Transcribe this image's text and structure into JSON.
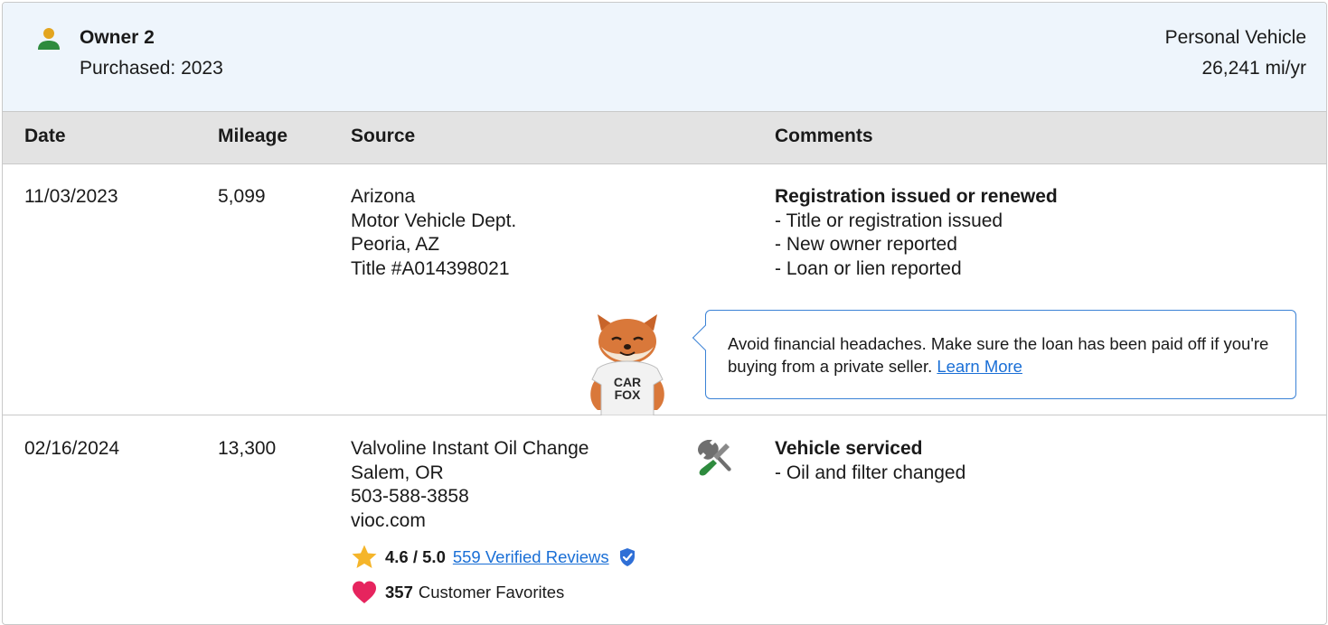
{
  "owner": {
    "title": "Owner 2",
    "purchased": "Purchased: 2023",
    "vehicle_type": "Personal Vehicle",
    "annual_mileage": "26,241 mi/yr",
    "icon": "person-icon"
  },
  "table": {
    "headers": {
      "date": "Date",
      "mileage": "Mileage",
      "source": "Source",
      "comments": "Comments"
    },
    "rows": [
      {
        "date": "11/03/2023",
        "mileage": "5,099",
        "source": [
          "Arizona",
          "Motor Vehicle Dept.",
          "Peoria, AZ",
          "Title #A014398021"
        ],
        "comment_title": "Registration issued or renewed",
        "comments": [
          "- Title or registration issued",
          "- New owner reported",
          "- Loan or lien reported"
        ],
        "callout": {
          "text": "Avoid financial headaches. Make sure the loan has been paid off if you're buying from a private seller.",
          "link": "Learn More"
        },
        "mascot_label": [
          "CAR",
          "FOX"
        ]
      },
      {
        "date": "02/16/2024",
        "mileage": "13,300",
        "source": [
          "Valvoline Instant Oil Change",
          "Salem, OR",
          "503-588-3858",
          "vioc.com"
        ],
        "comment_title": "Vehicle serviced",
        "comments": [
          "- Oil and filter changed"
        ],
        "icon": "wrench-screwdriver-icon",
        "rating": {
          "value": "4.6 / 5.0",
          "reviews_link": "559 Verified Reviews",
          "favorites_count": "357",
          "favorites_label": "Customer Favorites"
        }
      }
    ]
  },
  "colors": {
    "header_bg": "#eef5fc",
    "table_header_bg": "#e3e3e3",
    "link": "#1a6fd6",
    "callout_border": "#3b82d6",
    "owner_icon_head": "#e3a51f",
    "owner_icon_body": "#2e8b3e",
    "star": "#f5b52a",
    "heart": "#e6245e",
    "verified": "#2f6fd6"
  }
}
